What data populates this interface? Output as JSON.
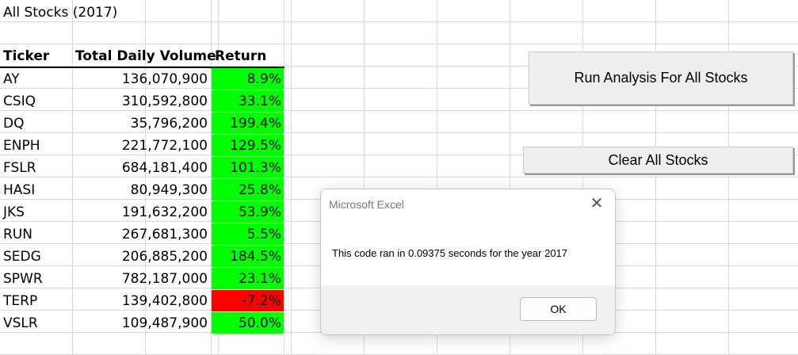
{
  "sheet": {
    "title": "All Stocks (2017)",
    "headers": {
      "ticker": "Ticker",
      "volume": "Total Daily Volume",
      "return": "Return"
    },
    "rows": [
      {
        "ticker": "AY",
        "volume": "136,070,900",
        "return": "8.9%",
        "positive": true
      },
      {
        "ticker": "CSIQ",
        "volume": "310,592,800",
        "return": "33.1%",
        "positive": true
      },
      {
        "ticker": "DQ",
        "volume": "35,796,200",
        "return": "199.4%",
        "positive": true
      },
      {
        "ticker": "ENPH",
        "volume": "221,772,100",
        "return": "129.5%",
        "positive": true
      },
      {
        "ticker": "FSLR",
        "volume": "684,181,400",
        "return": "101.3%",
        "positive": true
      },
      {
        "ticker": "HASI",
        "volume": "80,949,300",
        "return": "25.8%",
        "positive": true
      },
      {
        "ticker": "JKS",
        "volume": "191,632,200",
        "return": "53.9%",
        "positive": true
      },
      {
        "ticker": "RUN",
        "volume": "267,681,300",
        "return": "5.5%",
        "positive": true
      },
      {
        "ticker": "SEDG",
        "volume": "206,885,200",
        "return": "184.5%",
        "positive": true
      },
      {
        "ticker": "SPWR",
        "volume": "782,187,000",
        "return": "23.1%",
        "positive": true
      },
      {
        "ticker": "TERP",
        "volume": "139,402,800",
        "return": "-7.2%",
        "positive": false
      },
      {
        "ticker": "VSLR",
        "volume": "109,487,900",
        "return": "50.0%",
        "positive": true
      }
    ]
  },
  "buttons": {
    "run_label": "Run Analysis For All Stocks",
    "clear_label": "Clear All Stocks"
  },
  "dialog": {
    "title": "Microsoft Excel",
    "message": "This code ran in 0.09375 seconds for the year 2017",
    "ok_label": "OK",
    "close_icon": "close-icon"
  },
  "colors": {
    "positive_fill": "#00ff00",
    "negative_fill": "#ff0000",
    "gridline": "#dadada"
  }
}
